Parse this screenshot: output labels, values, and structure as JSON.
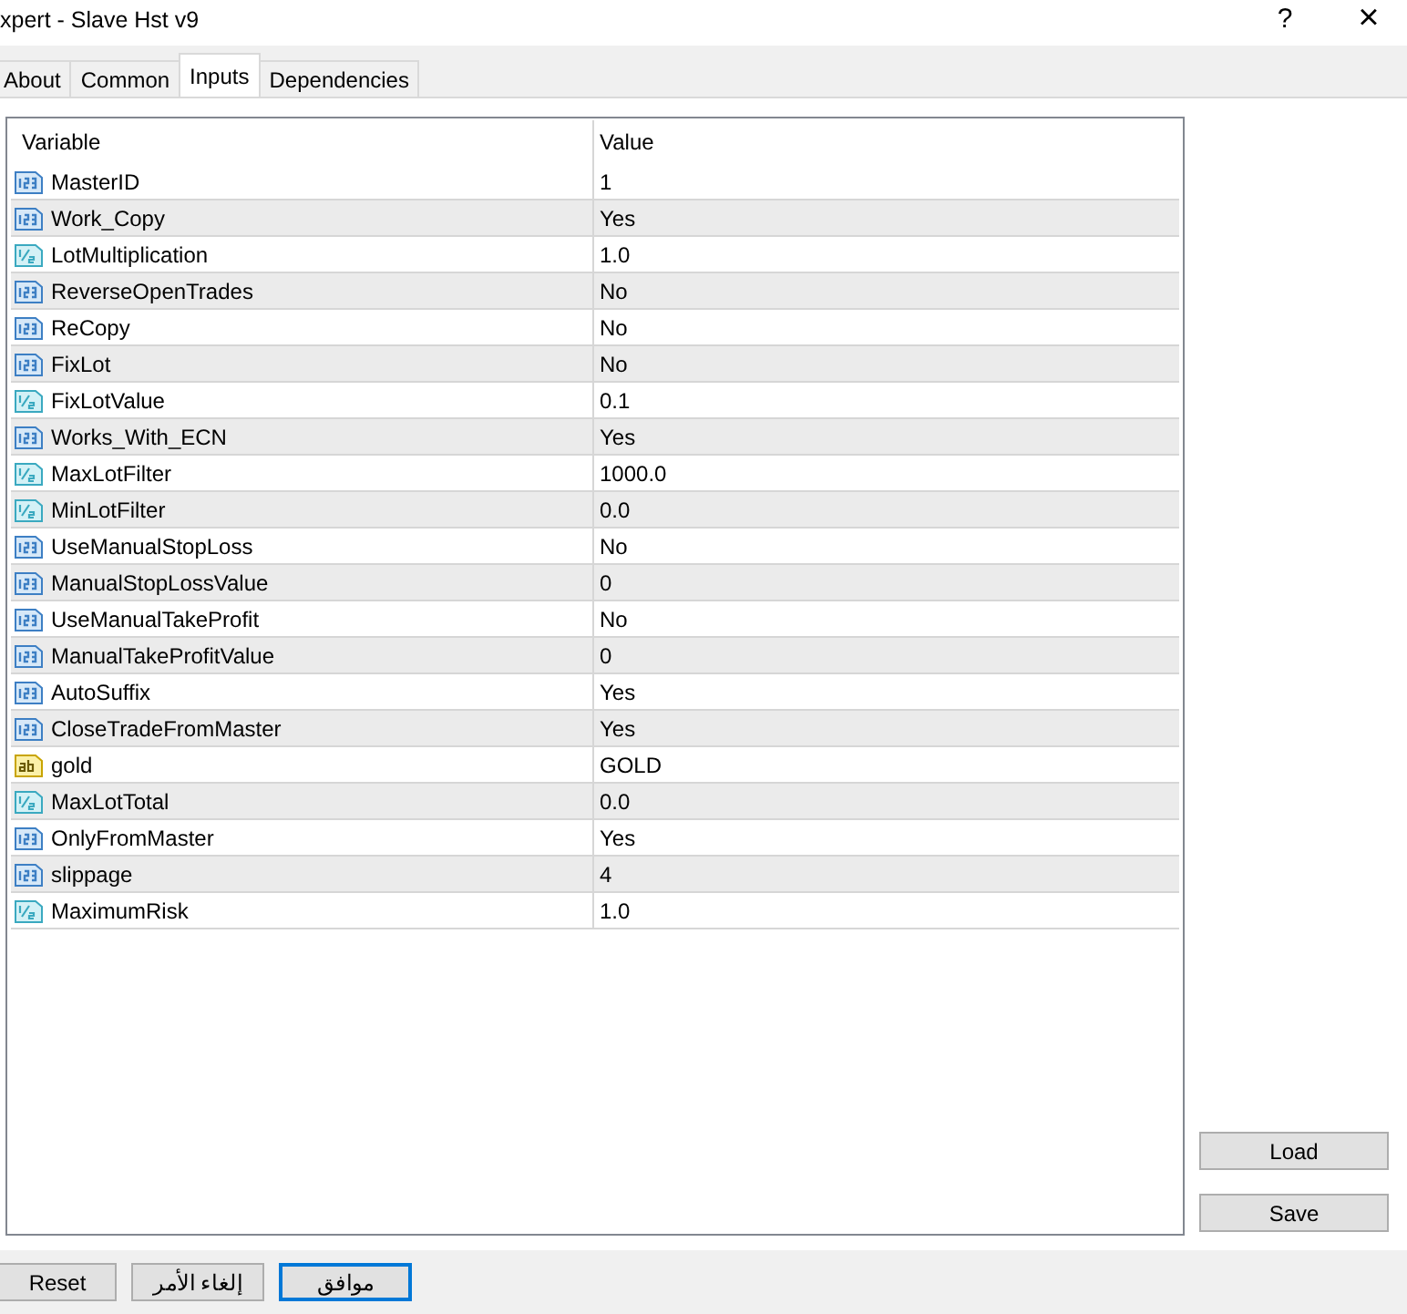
{
  "window": {
    "title": "xpert - Slave Hst v9",
    "help": "?",
    "close": "×"
  },
  "tabs": [
    {
      "label": "About",
      "selected": false
    },
    {
      "label": "Common",
      "selected": false
    },
    {
      "label": "Inputs",
      "selected": true
    },
    {
      "label": "Dependencies",
      "selected": false
    }
  ],
  "table": {
    "columns": [
      "Variable",
      "Value"
    ],
    "rows": [
      {
        "kind": "int",
        "variable": "MasterID",
        "value": "1"
      },
      {
        "kind": "int",
        "variable": "Work_Copy",
        "value": "Yes"
      },
      {
        "kind": "double",
        "variable": "LotMultiplication",
        "value": "1.0"
      },
      {
        "kind": "int",
        "variable": "ReverseOpenTrades",
        "value": "No"
      },
      {
        "kind": "int",
        "variable": "ReCopy",
        "value": "No"
      },
      {
        "kind": "int",
        "variable": "FixLot",
        "value": "No"
      },
      {
        "kind": "double",
        "variable": "FixLotValue",
        "value": "0.1"
      },
      {
        "kind": "int",
        "variable": "Works_With_ECN",
        "value": "Yes"
      },
      {
        "kind": "double",
        "variable": "MaxLotFilter",
        "value": "1000.0"
      },
      {
        "kind": "double",
        "variable": "MinLotFilter",
        "value": "0.0"
      },
      {
        "kind": "int",
        "variable": "UseManualStopLoss",
        "value": "No"
      },
      {
        "kind": "int",
        "variable": "ManualStopLossValue",
        "value": "0"
      },
      {
        "kind": "int",
        "variable": "UseManualTakeProfit",
        "value": "No"
      },
      {
        "kind": "int",
        "variable": "ManualTakeProfitValue",
        "value": "0"
      },
      {
        "kind": "int",
        "variable": "AutoSuffix",
        "value": "Yes"
      },
      {
        "kind": "int",
        "variable": "CloseTradeFromMaster",
        "value": "Yes"
      },
      {
        "kind": "string",
        "variable": "gold",
        "value": "GOLD"
      },
      {
        "kind": "double",
        "variable": "MaxLotTotal",
        "value": "0.0"
      },
      {
        "kind": "int",
        "variable": "OnlyFromMaster",
        "value": "Yes"
      },
      {
        "kind": "int",
        "variable": "slippage",
        "value": "4"
      },
      {
        "kind": "double",
        "variable": "MaximumRisk",
        "value": "1.0"
      }
    ]
  },
  "side_buttons": [
    "Load",
    "Save"
  ],
  "reset_button": "Reset",
  "dialog_buttons": [
    {
      "label": "موافق",
      "selected": true
    },
    {
      "label": "إلغاء الأمر",
      "selected": false
    }
  ]
}
